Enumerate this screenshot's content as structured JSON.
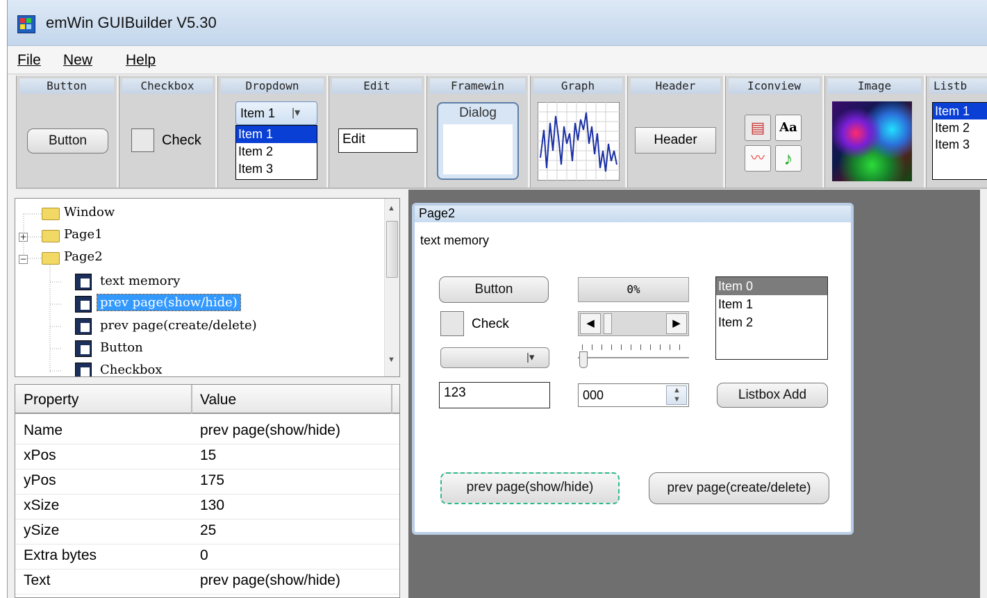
{
  "window": {
    "title": "emWin GUIBuilder V5.30"
  },
  "menu": [
    "File",
    "New",
    "Help"
  ],
  "toolbar": {
    "tools": [
      "Button",
      "Checkbox",
      "Dropdown",
      "Edit",
      "Framewin",
      "Graph",
      "Header",
      "Iconview",
      "Image",
      "Listb"
    ],
    "button_preview": "Button",
    "checkbox_preview": "Check",
    "dropdown_selected": "Item 1",
    "dropdown_items": [
      "Item 1",
      "Item 2",
      "Item 3"
    ],
    "edit_preview": "Edit",
    "framewin_preview": "Dialog",
    "header_preview": "Header",
    "listbox_items": [
      "Item 1",
      "Item 2",
      "Item 3"
    ]
  },
  "tree": {
    "nodes": [
      "Window",
      "Page1",
      "Page2",
      "text memory",
      "prev page(show/hide)",
      "prev page(create/delete)",
      "Button",
      "Checkbox"
    ],
    "selected": "prev page(show/hide)"
  },
  "properties": {
    "headers": [
      "Property",
      "Value"
    ],
    "rows": [
      {
        "key": "Name",
        "value": "prev page(show/hide)"
      },
      {
        "key": "xPos",
        "value": "15"
      },
      {
        "key": "yPos",
        "value": "175"
      },
      {
        "key": "xSize",
        "value": "130"
      },
      {
        "key": "ySize",
        "value": "25"
      },
      {
        "key": "Extra bytes",
        "value": "0"
      },
      {
        "key": "Text",
        "value": "prev page(show/hide)"
      }
    ]
  },
  "page2": {
    "title": "Page2",
    "text": "text memory",
    "button": "Button",
    "progress": "0%",
    "check": "Check",
    "listbox": [
      "Item 0",
      "Item 1",
      "Item 2"
    ],
    "edit_value": "123",
    "spinbox_value": "000",
    "listbox_add": "Listbox Add",
    "prev_show_hide": "prev page(show/hide)",
    "prev_create_delete": "prev page(create/delete)"
  }
}
